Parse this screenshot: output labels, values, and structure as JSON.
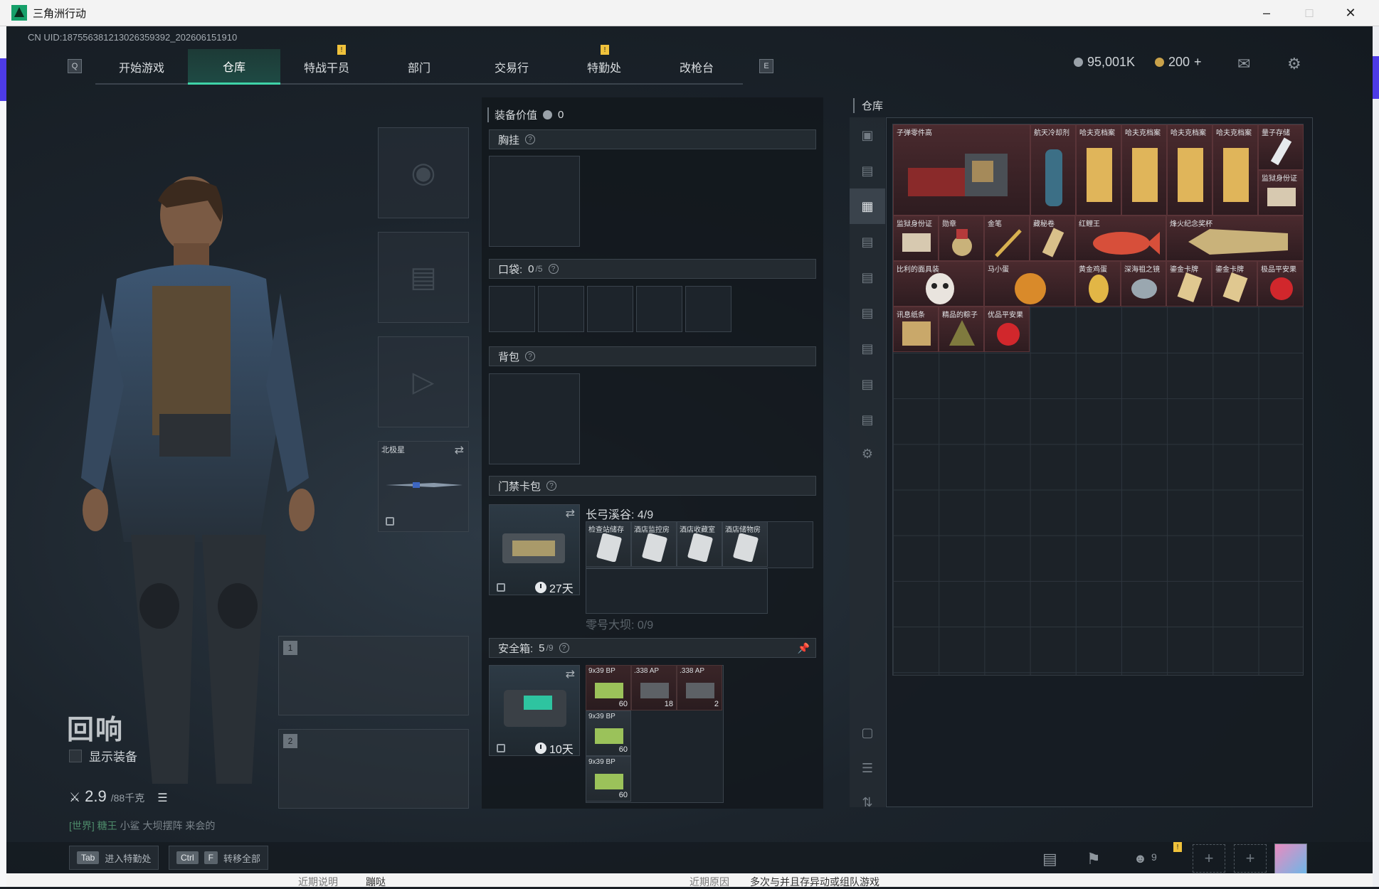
{
  "window": {
    "title": "三角洲行动"
  },
  "uid": "CN UID:187556381213026359392_202606151910",
  "nav": {
    "left_key": "Q",
    "right_key": "E",
    "tabs": [
      {
        "label": "开始游戏"
      },
      {
        "label": "仓库"
      },
      {
        "label": "特战干员"
      },
      {
        "label": "部门"
      },
      {
        "label": "交易行"
      },
      {
        "label": "特勤处"
      },
      {
        "label": "改枪台"
      }
    ],
    "badge": "!"
  },
  "currency": {
    "coins": "95,001K",
    "tickets": "200",
    "add": "+"
  },
  "operator": {
    "name": "回响",
    "show_equipment": "显示装备",
    "weight": "2.9",
    "weight_max": "/88千克",
    "chat_channel": "[世界]",
    "chat_user": "糖王",
    "chat_msg": "小鲨 大坝摆阵 来会的"
  },
  "weapon_slots": [
    {
      "index": "1"
    },
    {
      "index": "2"
    }
  ],
  "melee": {
    "name": "北极星"
  },
  "equipment": {
    "value_label": "装备价值",
    "value": "0",
    "chest_rig": "胸挂",
    "pockets": "口袋:",
    "pockets_count": "0",
    "pockets_max": "/5",
    "backpack": "背包",
    "keycard": "门禁卡包",
    "keycard_timer": "27天",
    "keycard_map1": "长弓溪谷: 4/9",
    "keycard_map2": "零号大坝: 0/9",
    "keycard_items": [
      "检查站储存",
      "酒店监控房",
      "酒店收藏室",
      "酒店储物房"
    ],
    "safebox": "安全箱:",
    "safebox_count": "5",
    "safebox_max": "/9",
    "safebox_timer": "10天",
    "safebox_items": [
      {
        "label": "9x39 BP",
        "count": "60"
      },
      {
        "label": ".338 AP",
        "count": "18"
      },
      {
        "label": ".338 AP",
        "count": "2"
      },
      {
        "label": "9x39 BP",
        "count": "60"
      },
      {
        "label": "9x39 BP",
        "count": "60"
      }
    ]
  },
  "warehouse": {
    "title": "仓库",
    "items": [
      "子弹零件高",
      "航天冷却剂",
      "哈夫克档案",
      "哈夫克档案",
      "哈夫克档案",
      "哈夫克档案",
      "量子存储",
      "监狱身份证",
      "监狱身份证",
      "勋章",
      "金笔",
      "藏秘卷",
      "红鲤王",
      "烽火纪念奖杯",
      "比利的面具装",
      "马小蛋",
      "黄金鸡蛋",
      "深海祖之镜",
      "鎏金卡牌",
      "鎏金卡牌",
      "极品平安果",
      "讯息纸条",
      "精品的粽子",
      "优品平安果"
    ]
  },
  "bottom": {
    "tab_key": "Tab",
    "enter_label": "进入特勤处",
    "ctrl_key": "Ctrl",
    "f_key": "F",
    "transfer_label": "转移全部",
    "friends": "9",
    "strip_left": "近期说明",
    "strip_left2": "蹦哒",
    "strip_right": "近期原因",
    "strip_right2": "多次与并且存异动或组队游戏"
  },
  "colors": {
    "accent": "#3fd3a8",
    "item_red": "#4a2a2e",
    "badge": "#f0c23b"
  }
}
